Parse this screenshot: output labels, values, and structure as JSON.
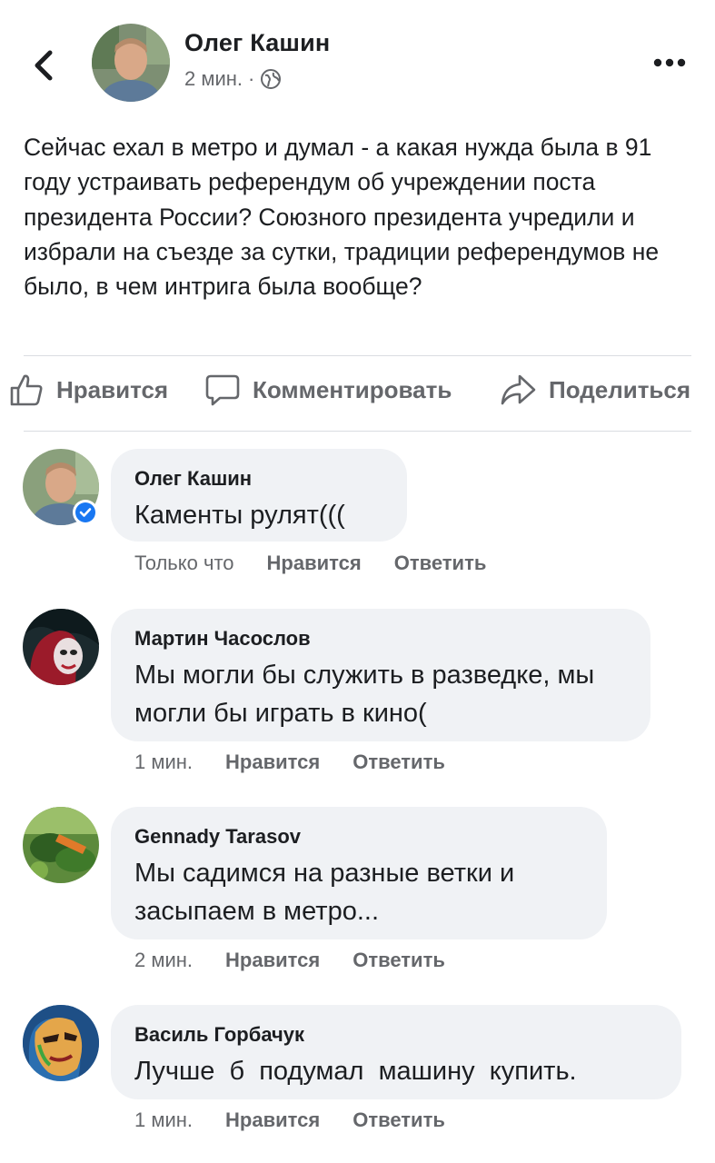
{
  "header": {
    "author": "Олег Кашин",
    "time": "2 мин.",
    "separator": "·"
  },
  "post": {
    "text": "Сейчас ехал в метро и думал - а какая нужда была в 91 году устраивать референдум об учреждении поста президента России? Союзного президента учредили и избрали на съезде за сутки, традиции референдумов не было, в чем интрига была вообще?"
  },
  "actions": {
    "like": "Нравится",
    "comment": "Комментировать",
    "share": "Поделиться"
  },
  "comments": [
    {
      "author": "Олег Кашин",
      "text": "Каменты рулят(((",
      "time": "Только что",
      "like": "Нравится",
      "reply": "Ответить",
      "verified": true
    },
    {
      "author": "Мартин Часослов",
      "text": "Мы могли бы служить в разведке, мы могли бы играть в кино(",
      "time": "1 мин.",
      "like": "Нравится",
      "reply": "Ответить"
    },
    {
      "author": "Gennady Tarasov",
      "text": "Мы садимся на разные ветки и засыпаем в метро...",
      "time": "2 мин.",
      "like": "Нравится",
      "reply": "Ответить"
    },
    {
      "author": "Василь Горбачук",
      "text": "Лучше  б  подумал  машину  купить.",
      "time": "1 мин.",
      "like": "Нравится",
      "reply": "Ответить"
    }
  ],
  "colors": {
    "text": "#1c1e21",
    "secondary": "#65676b",
    "bubble": "#f0f2f5",
    "verified": "#1877f2"
  }
}
